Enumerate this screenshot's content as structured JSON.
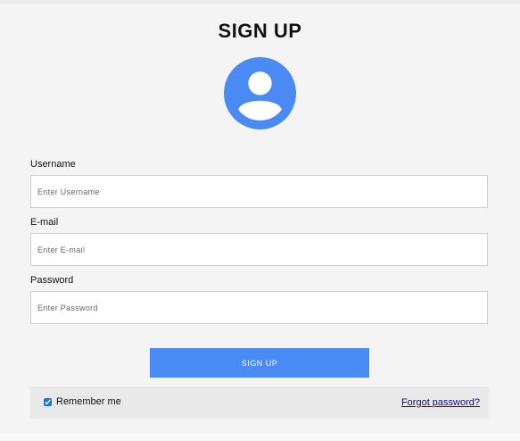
{
  "form": {
    "title": "SIGN UP",
    "avatar_icon": "user-circle-icon",
    "accent_color": "#4a8af4",
    "fields": {
      "username": {
        "label": "Username",
        "placeholder": "Enter Username",
        "value": ""
      },
      "email": {
        "label": "E-mail",
        "placeholder": "Enter E-mail",
        "value": ""
      },
      "password": {
        "label": "Password",
        "placeholder": "Enter Password",
        "value": ""
      }
    },
    "submit_label": "SIGN UP",
    "remember_label": "Remember me",
    "remember_checked": true,
    "forgot_label": "Forgot password?"
  }
}
